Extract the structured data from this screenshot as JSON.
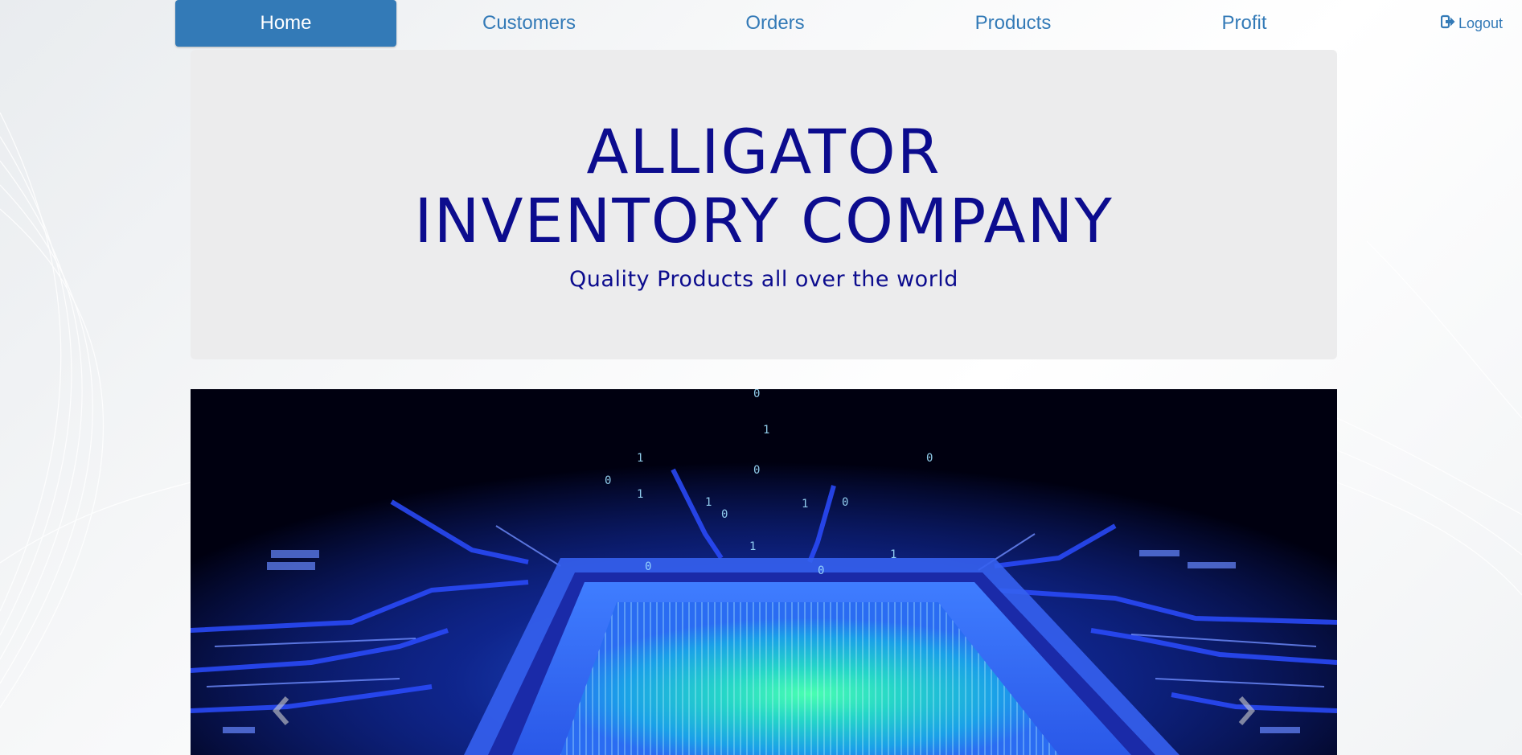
{
  "nav": {
    "items": [
      {
        "label": "Home",
        "active": true
      },
      {
        "label": "Customers",
        "active": false
      },
      {
        "label": "Orders",
        "active": false
      },
      {
        "label": "Products",
        "active": false
      },
      {
        "label": "Profit",
        "active": false
      }
    ],
    "logout_label": "Logout",
    "logout_icon": "logout-icon"
  },
  "hero": {
    "title_line1": "ALLIGATOR",
    "title_line2": "INVENTORY COMPANY",
    "subtitle": "Quality Products all over the world"
  },
  "carousel": {
    "slide_image": "circuit-board-chip-image",
    "prev_icon": "chevron-left-icon",
    "next_icon": "chevron-right-icon"
  },
  "colors": {
    "accent": "#337ab7",
    "title": "#0c0c8e",
    "hero_bg": "#ececed"
  }
}
